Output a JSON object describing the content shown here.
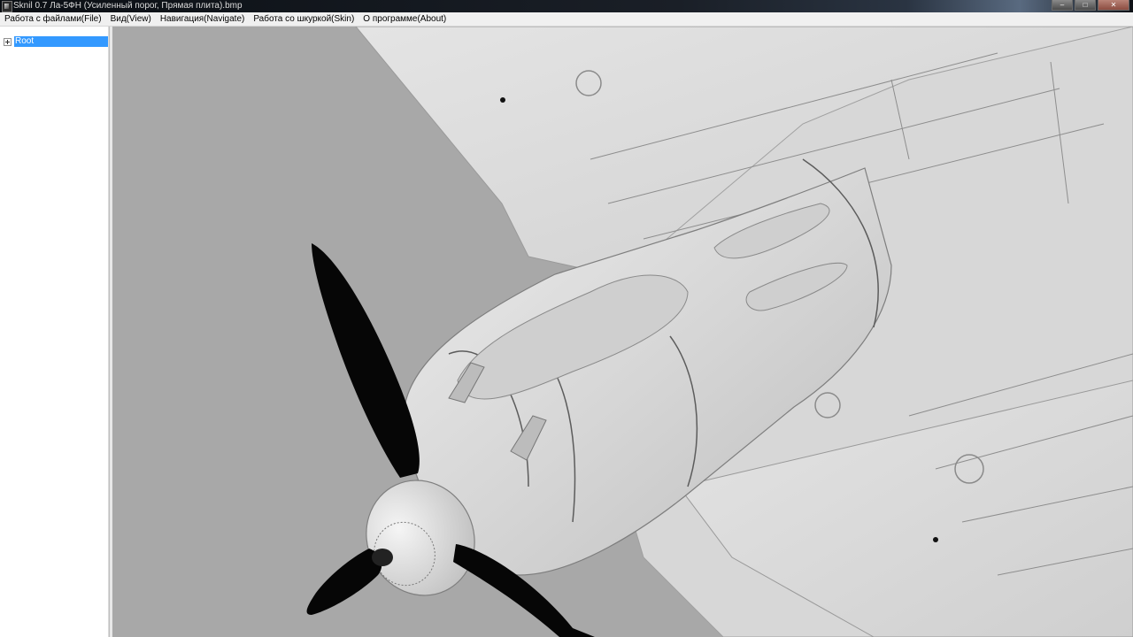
{
  "window": {
    "title": "Sknil 0.7   Ла-5ФН (Усиленный порог, Прямая плита).bmp",
    "controls": [
      "–",
      "□",
      "✕"
    ]
  },
  "menu": {
    "items": [
      {
        "label": "Работа с файлами(File)"
      },
      {
        "label": "Вид(View)"
      },
      {
        "label": "Навигация(Navigate)"
      },
      {
        "label": "Работа со шкуркой(Skin)"
      },
      {
        "label": "О программе(About)"
      }
    ]
  },
  "tree": {
    "root_label": "Root",
    "selection_color": "#3399ff"
  },
  "viewport": {
    "background_color": "#a8a8a8",
    "model": "aircraft-3d-model",
    "model_color": "#dcdcdc",
    "propeller_color": "#050505"
  }
}
